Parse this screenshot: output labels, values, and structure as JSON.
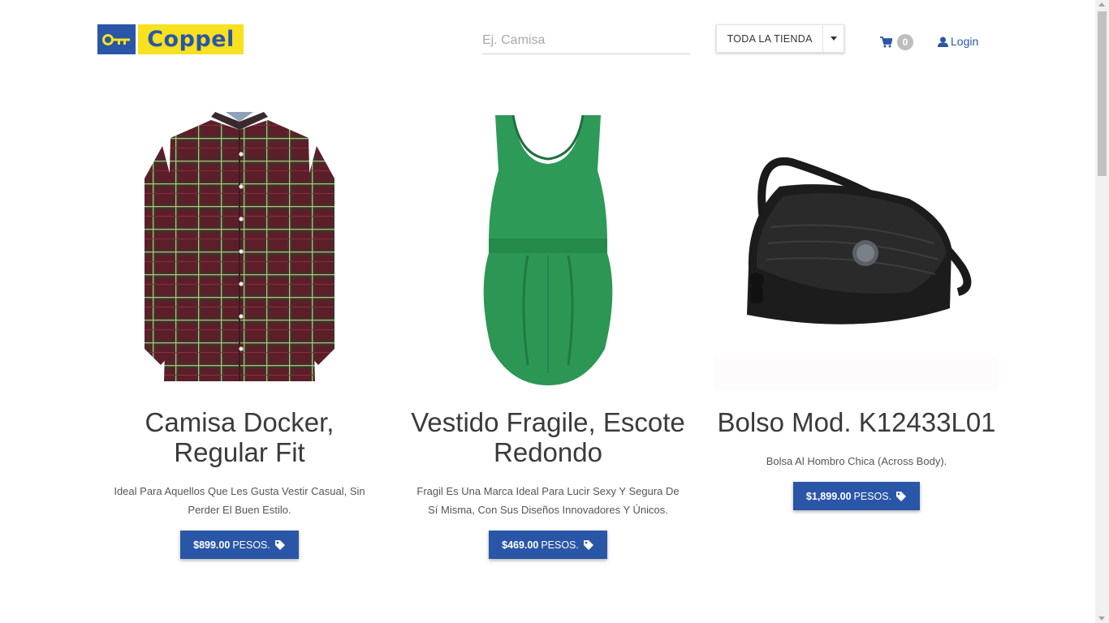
{
  "brand": {
    "logo_text": "Coppel",
    "primary_color": "#2a56a7",
    "accent_color": "#f7e120"
  },
  "search": {
    "placeholder": "Ej. Camisa",
    "value": ""
  },
  "store_filter": {
    "selected": "TODA LA TIENDA"
  },
  "cart": {
    "count": "0",
    "icon": "cart-icon"
  },
  "login": {
    "label": "Login",
    "icon": "user-icon"
  },
  "products": [
    {
      "title": "Camisa Docker, Regular Fit",
      "description": "Ideal Para Aquellos Que Les Gusta Vestir Casual, Sin Perder El Buen Estilo.",
      "price": "$899.00",
      "currency": "PESOS.",
      "image": "plaid-shirt"
    },
    {
      "title": "Vestido Fragile, Escote Redondo",
      "description": "Fragil Es Una Marca Ideal Para Lucir Sexy Y Segura De Sí Misma, Con Sus Diseños Innovadores Y Únicos.",
      "price": "$469.00",
      "currency": "PESOS.",
      "image": "green-dress"
    },
    {
      "title": "Bolso Mod. K12433L01",
      "description": "Bolsa Al Hombro Chica (Across Body).",
      "price": "$1,899.00",
      "currency": "PESOS.",
      "image": "black-bag"
    }
  ]
}
